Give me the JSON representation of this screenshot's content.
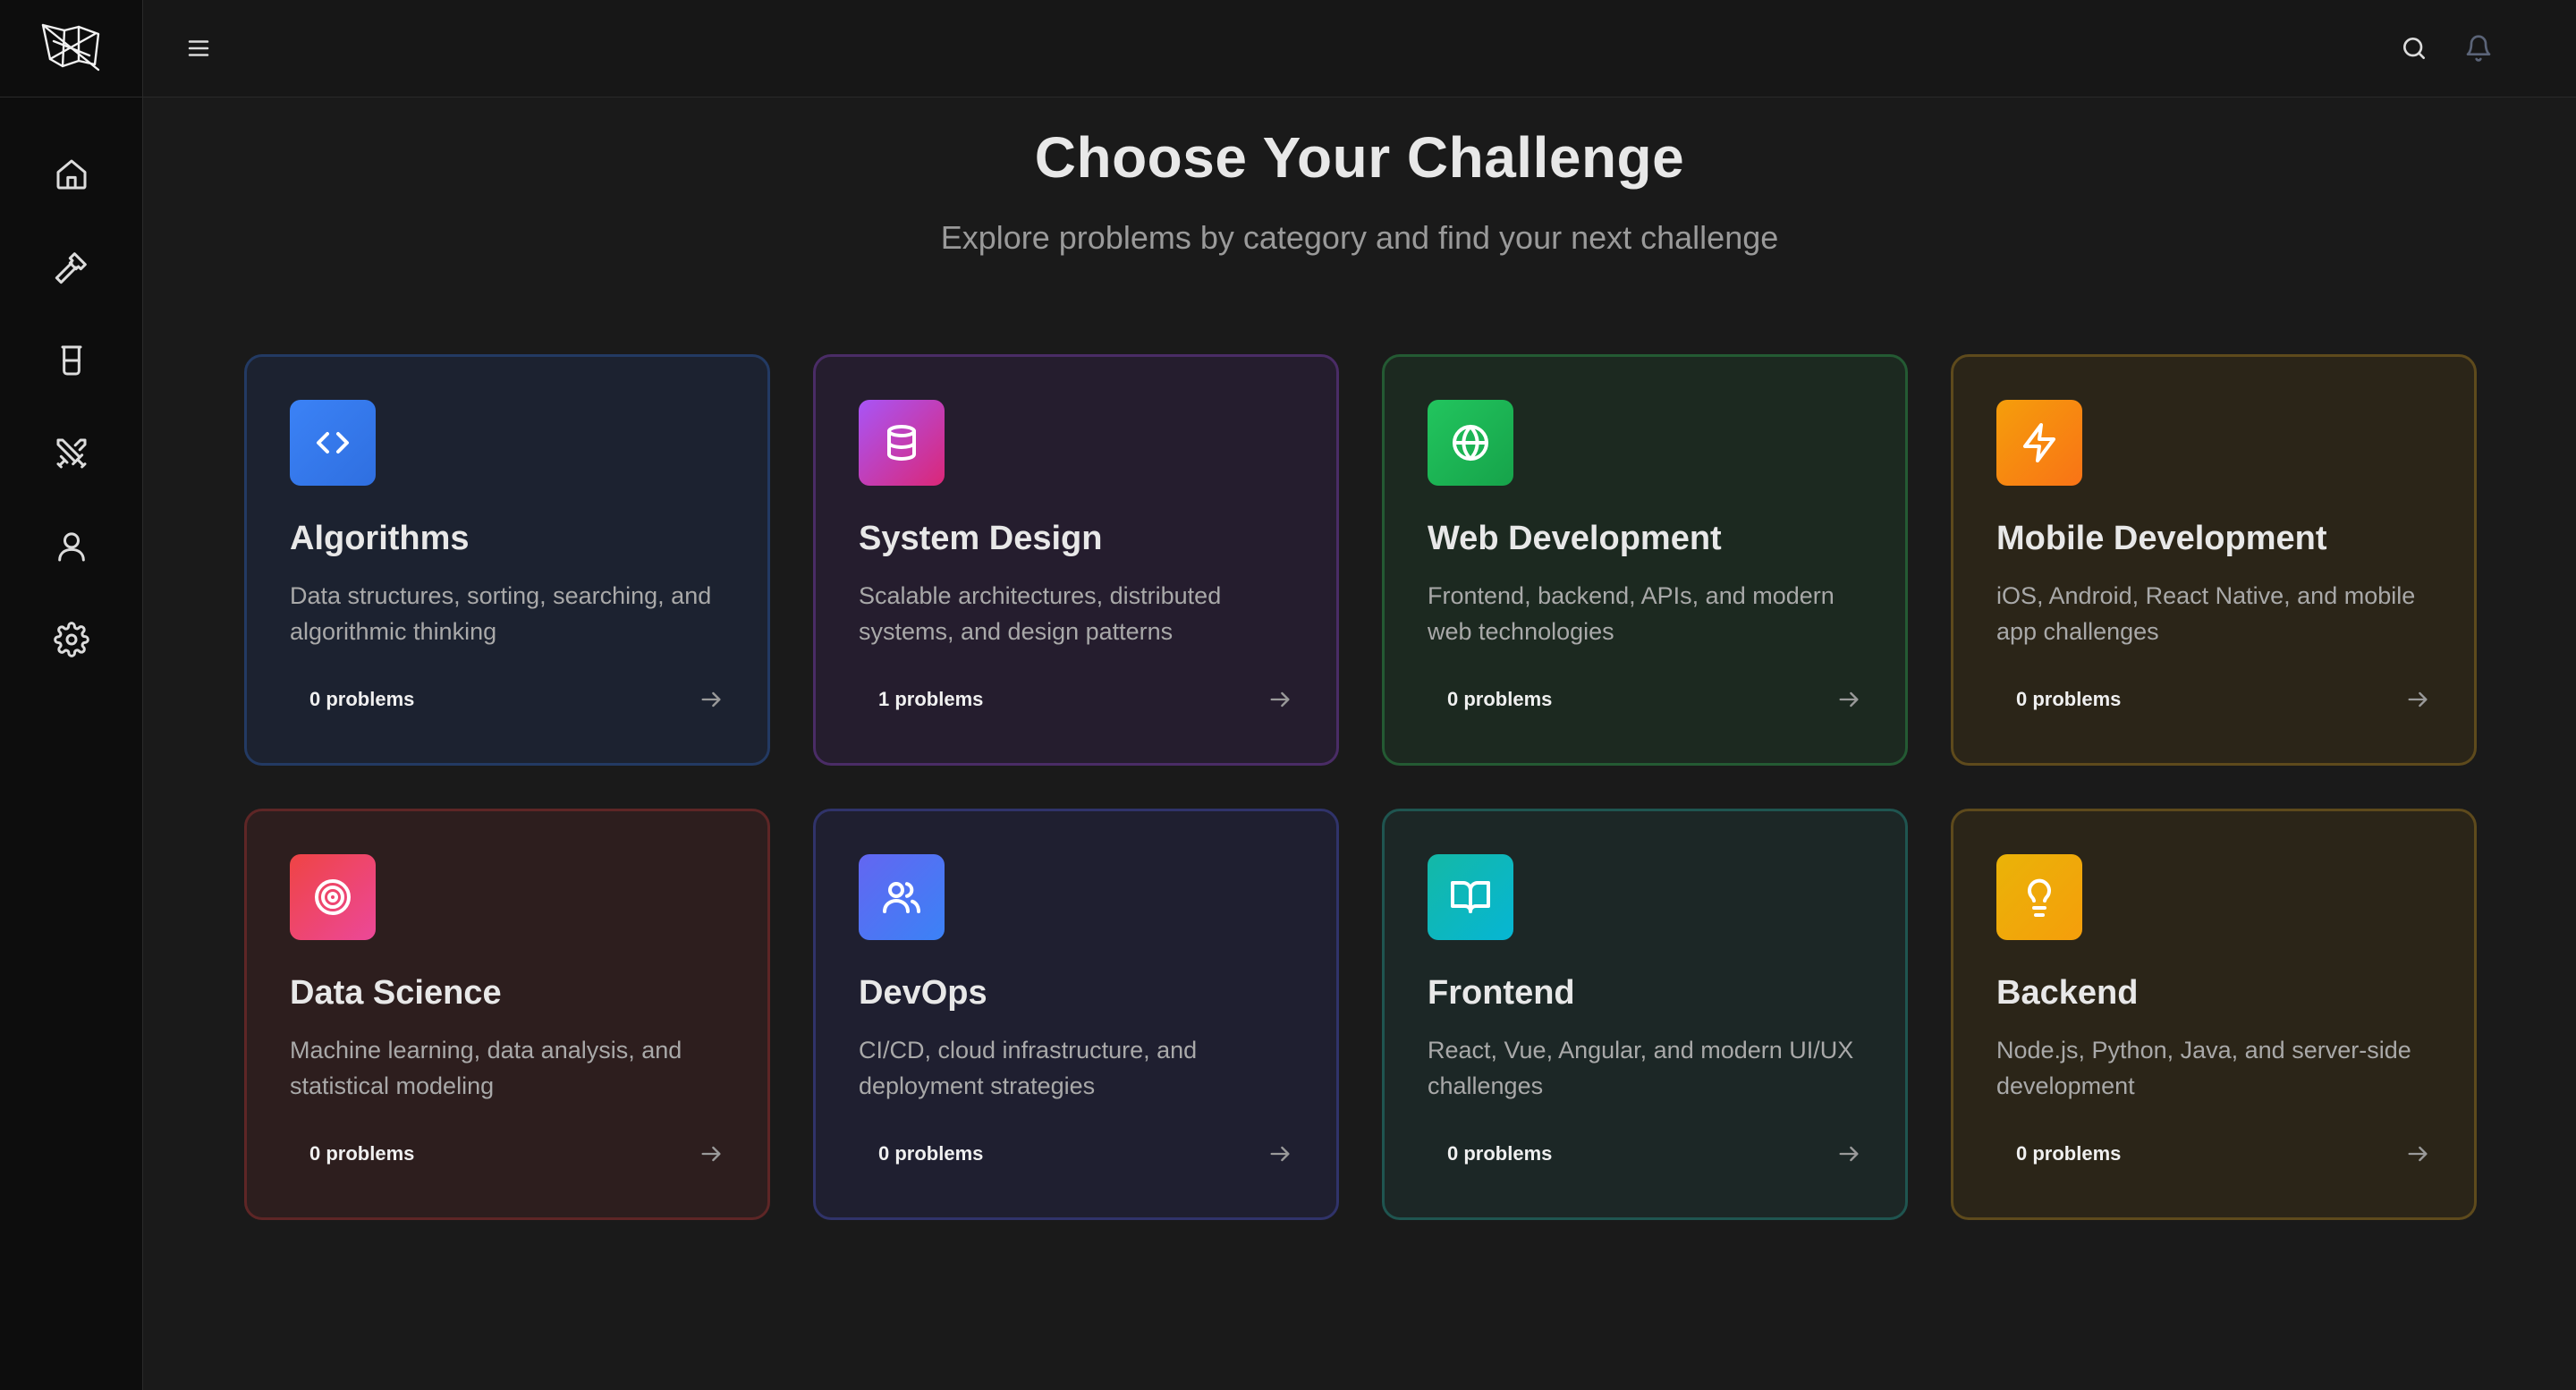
{
  "sidebar": {
    "logo_icon": "flag-logo-icon",
    "items": [
      {
        "name": "home",
        "icon": "home-icon"
      },
      {
        "name": "hammer",
        "icon": "hammer-icon"
      },
      {
        "name": "beaker",
        "icon": "beaker-icon"
      },
      {
        "name": "swords",
        "icon": "swords-icon"
      },
      {
        "name": "profile",
        "icon": "user-icon"
      },
      {
        "name": "settings",
        "icon": "gear-icon"
      }
    ]
  },
  "topbar": {
    "menu_icon": "hamburger-menu-icon",
    "search_icon": "search-icon",
    "bell_icon": "bell-icon"
  },
  "main": {
    "title": "Choose Your Challenge",
    "subtitle": "Explore problems by category and find your next challenge"
  },
  "cards": [
    {
      "title": "Algorithms",
      "desc": "Data structures, sorting, searching, and algorithmic thinking",
      "count": "0 problems",
      "icon": "code-icon",
      "accent": "#3b82f6"
    },
    {
      "title": "System Design",
      "desc": "Scalable architectures, distributed systems, and design patterns",
      "count": "1 problems",
      "icon": "database-icon",
      "accent": "#a855f7"
    },
    {
      "title": "Web Development",
      "desc": "Frontend, backend, APIs, and modern web technologies",
      "count": "0 problems",
      "icon": "globe-icon",
      "accent": "#22c55e"
    },
    {
      "title": "Mobile Development",
      "desc": "iOS, Android, React Native, and mobile app challenges",
      "count": "0 problems",
      "icon": "lightning-icon",
      "accent": "#f59e0b"
    },
    {
      "title": "Data Science",
      "desc": "Machine learning, data analysis, and statistical modeling",
      "count": "0 problems",
      "icon": "target-icon",
      "accent": "#ef4444"
    },
    {
      "title": "DevOps",
      "desc": "CI/CD, cloud infrastructure, and deployment strategies",
      "count": "0 problems",
      "icon": "users-icon",
      "accent": "#6366f1"
    },
    {
      "title": "Frontend",
      "desc": "React, Vue, Angular, and modern UI/UX challenges",
      "count": "0 problems",
      "icon": "book-icon",
      "accent": "#14b8a6"
    },
    {
      "title": "Backend",
      "desc": "Node.js, Python, Java, and server-side development",
      "count": "0 problems",
      "icon": "lightbulb-icon",
      "accent": "#eab308"
    }
  ]
}
